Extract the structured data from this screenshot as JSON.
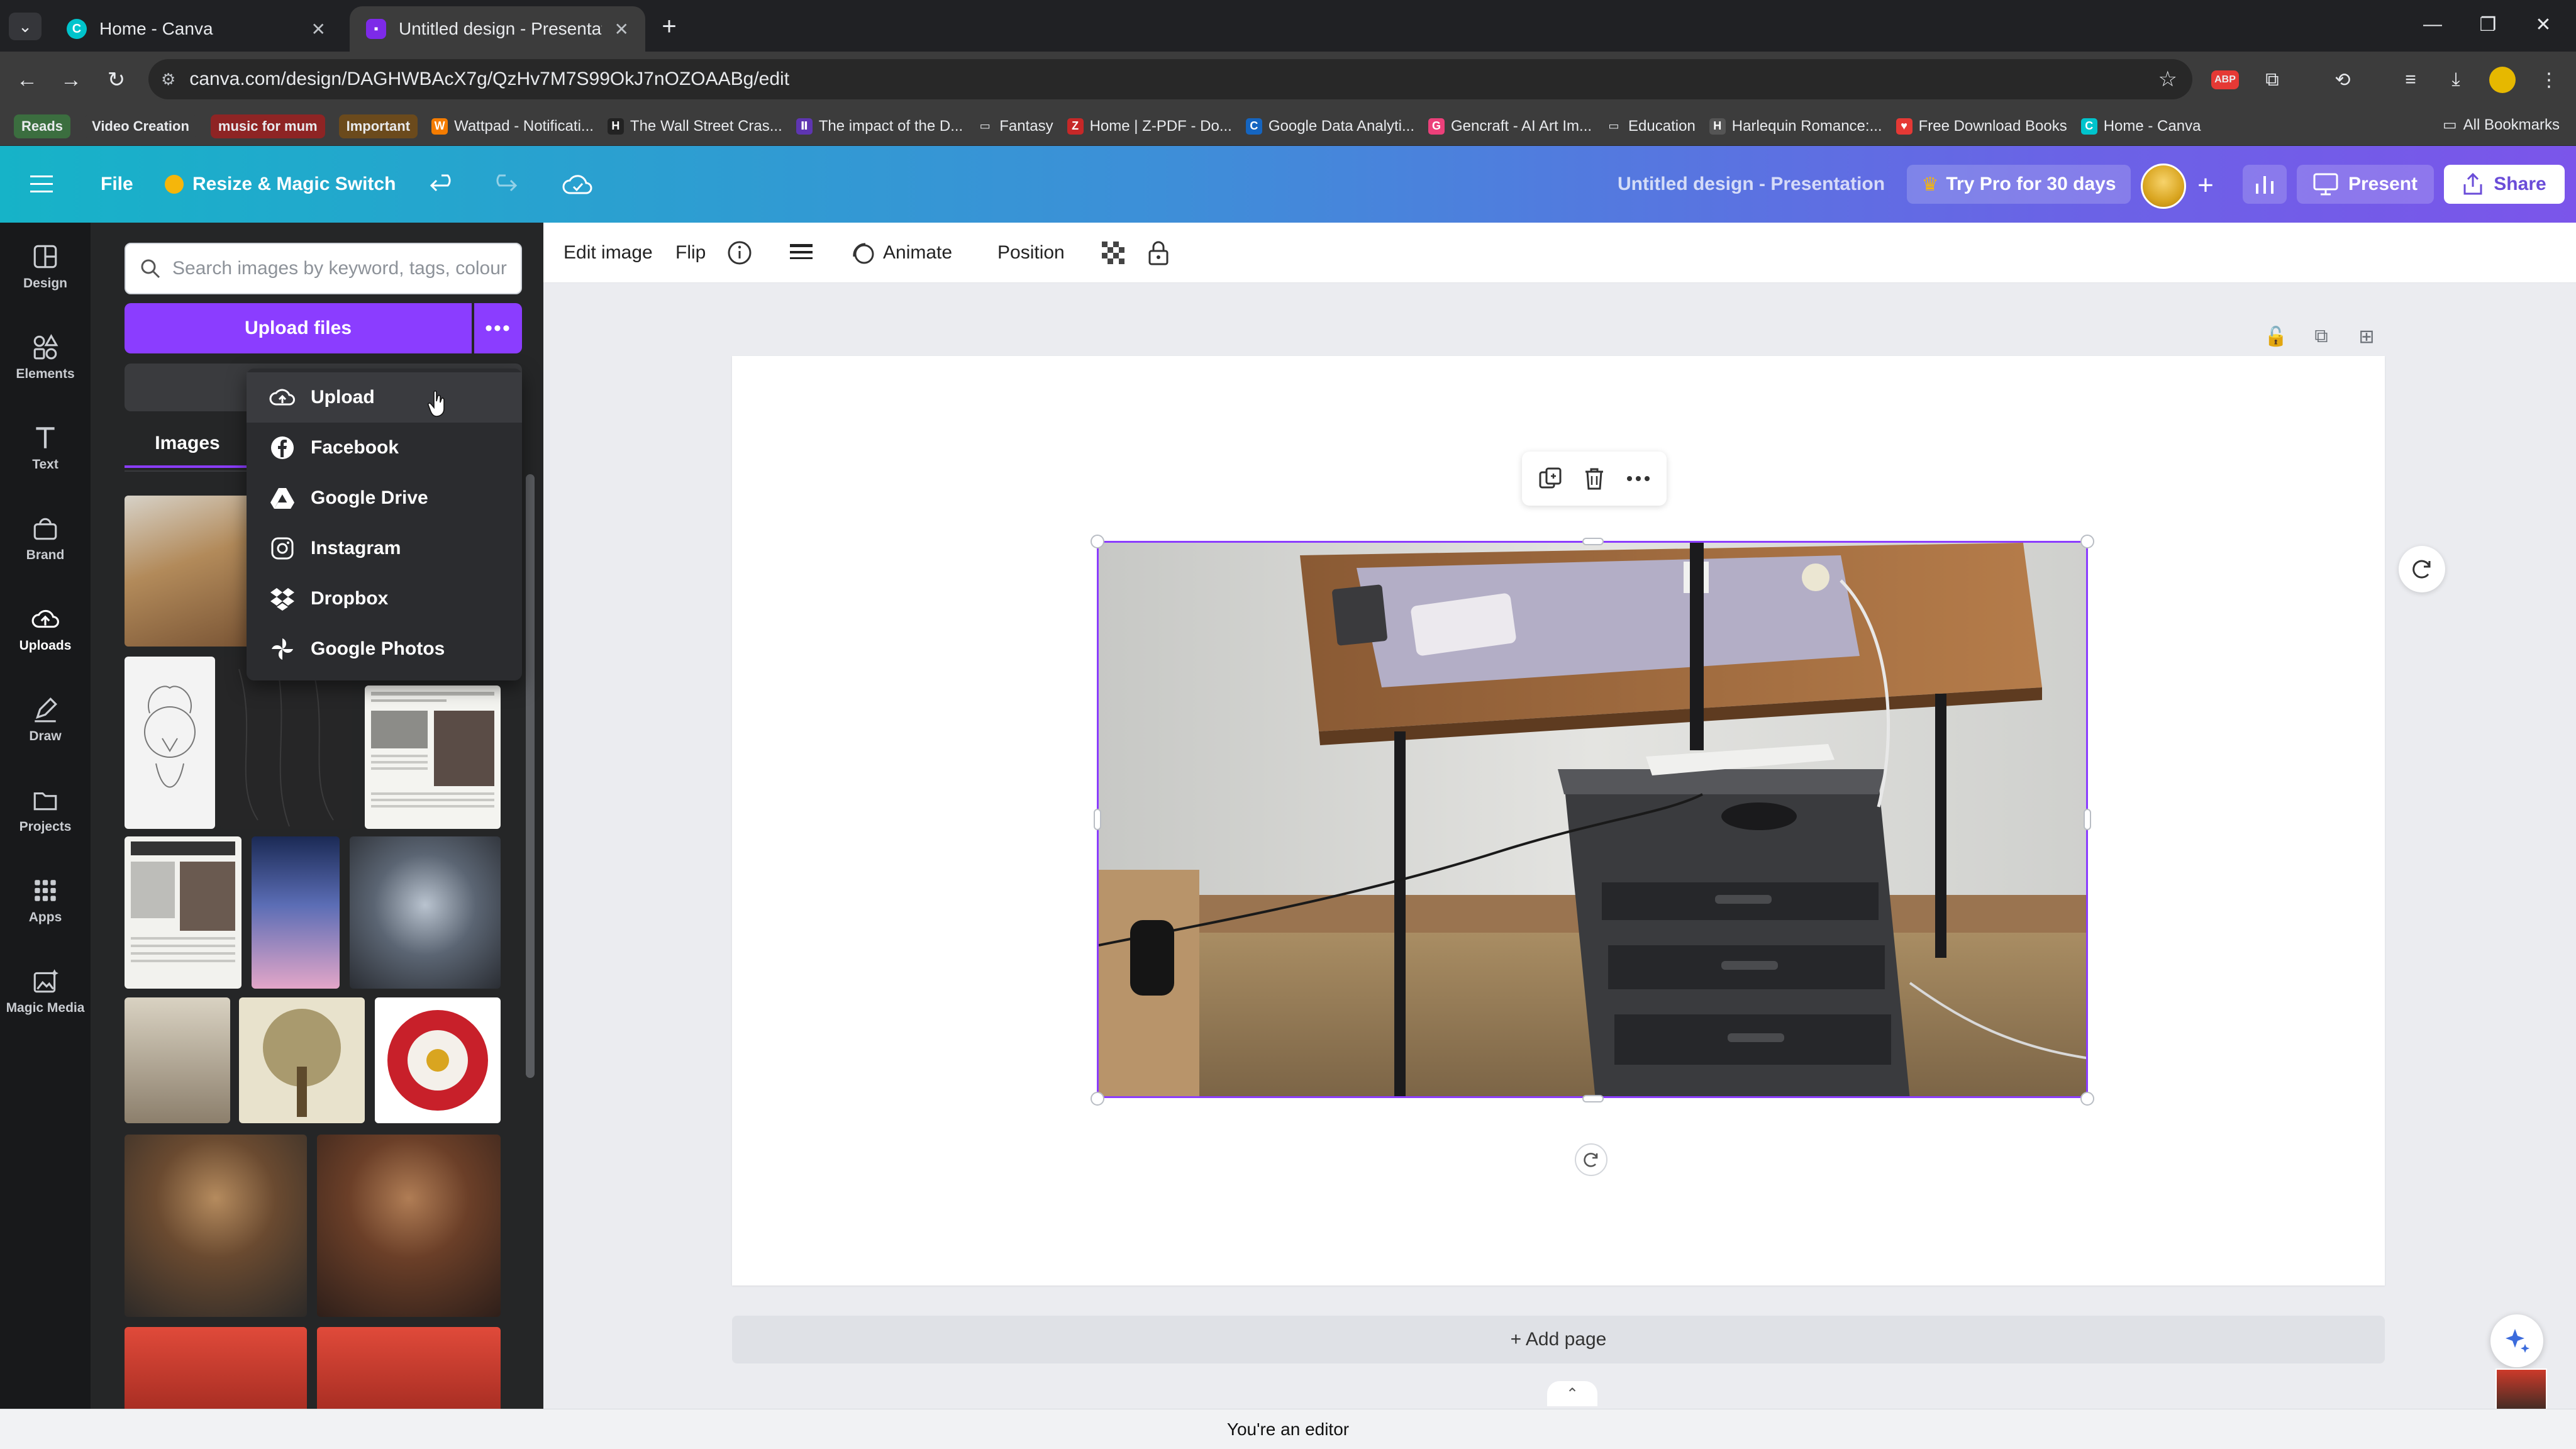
{
  "browser": {
    "tabs": [
      {
        "title": "Home - Canva",
        "active": false
      },
      {
        "title": "Untitled design - Presentation",
        "active": true
      }
    ],
    "url": "canva.com/design/DAGHWBAcX7g/QzHv7M7S99OkJ7nOZOAABg/edit",
    "bookmarks": [
      {
        "label": "Reads",
        "chip": true,
        "bg": "#3b6e3f"
      },
      {
        "label": "Video Creation",
        "chip": true,
        "bg": "#3c3c3c"
      },
      {
        "label": "music for mum",
        "chip": true,
        "bg": "#8e2424"
      },
      {
        "label": "Important",
        "chip": true,
        "bg": "#6b4a1c"
      },
      {
        "label": "Wattpad - Notificati...",
        "icon": "W",
        "color": "#f57c00"
      },
      {
        "label": "The Wall Street Cras...",
        "icon": "H",
        "color": "#222222"
      },
      {
        "label": "The impact of the D...",
        "icon": "Ⅱ",
        "color": "#5e35b1"
      },
      {
        "label": "Fantasy",
        "icon": "📁",
        "color": "transparent"
      },
      {
        "label": "Home | Z-PDF - Do...",
        "icon": "Z",
        "color": "#c62828"
      },
      {
        "label": "Google Data Analyti...",
        "icon": "C",
        "color": "#1565c0"
      },
      {
        "label": "Gencraft - AI Art Im...",
        "icon": "G",
        "color": "#ec407a"
      },
      {
        "label": "Education",
        "icon": "📁",
        "color": "transparent"
      },
      {
        "label": "Harlequin Romance:...",
        "icon": "H",
        "color": "#555555"
      },
      {
        "label": "Free Download Books",
        "icon": "♥",
        "color": "#e53935"
      },
      {
        "label": "Home - Canva",
        "icon": "C",
        "color": "#00c4cc"
      }
    ],
    "all_bookmarks": "All Bookmarks"
  },
  "header": {
    "file": "File",
    "resize": "Resize & Magic Switch",
    "title": "Untitled design - Presentation",
    "pro": "Try Pro for 30 days",
    "present": "Present",
    "share": "Share"
  },
  "rail": [
    {
      "label": "Design",
      "icon": "design-icon"
    },
    {
      "label": "Elements",
      "icon": "elements-icon"
    },
    {
      "label": "Text",
      "icon": "text-icon"
    },
    {
      "label": "Brand",
      "icon": "brand-icon"
    },
    {
      "label": "Uploads",
      "icon": "uploads-icon",
      "active": true
    },
    {
      "label": "Draw",
      "icon": "draw-icon"
    },
    {
      "label": "Projects",
      "icon": "projects-icon"
    },
    {
      "label": "Apps",
      "icon": "apps-icon"
    },
    {
      "label": "Magic Media",
      "icon": "magic-media-icon"
    }
  ],
  "panel": {
    "search_placeholder": "Search images by keyword, tags, colour",
    "upload_btn": "Upload files",
    "tab_images": "Images"
  },
  "dropdown": [
    {
      "label": "Upload",
      "icon": "cloud-upload-icon"
    },
    {
      "label": "Facebook",
      "icon": "facebook-icon"
    },
    {
      "label": "Google Drive",
      "icon": "google-drive-icon"
    },
    {
      "label": "Instagram",
      "icon": "instagram-icon"
    },
    {
      "label": "Dropbox",
      "icon": "dropbox-icon"
    },
    {
      "label": "Google Photos",
      "icon": "google-photos-icon"
    }
  ],
  "toolbar": {
    "edit_image": "Edit image",
    "flip": "Flip",
    "animate": "Animate",
    "position": "Position"
  },
  "canvas": {
    "add_page": "+ Add page"
  },
  "status": "You're an editor",
  "colors": {
    "accent": "#8b3dff",
    "rail_bg": "#18191b",
    "panel_bg": "#252627"
  }
}
